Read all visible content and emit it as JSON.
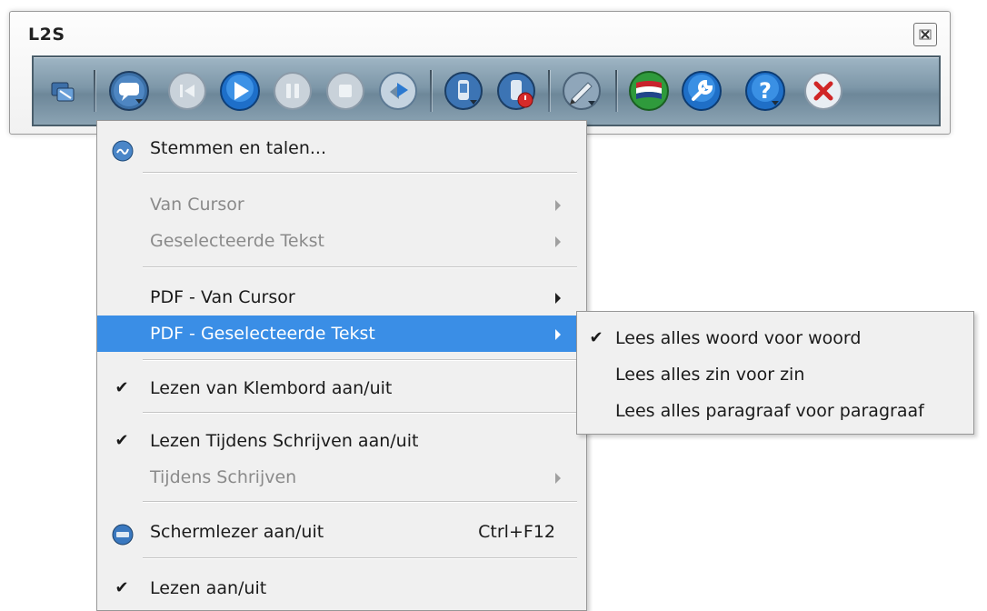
{
  "window": {
    "title": "L2S",
    "close_icon": "close-box-icon"
  },
  "toolbar": {
    "buttons": [
      {
        "name": "resize-icon"
      },
      {
        "name": "speech-bubble-menu-icon"
      },
      {
        "name": "previous-icon"
      },
      {
        "name": "play-icon"
      },
      {
        "name": "pause-icon"
      },
      {
        "name": "stop-icon"
      },
      {
        "name": "next-icon"
      },
      {
        "name": "save-audio-icon"
      },
      {
        "name": "record-audio-icon"
      },
      {
        "name": "pen-icon"
      },
      {
        "name": "dutch-flag-icon"
      },
      {
        "name": "settings-wrench-icon"
      },
      {
        "name": "help-icon"
      },
      {
        "name": "exit-icon"
      }
    ]
  },
  "menu": {
    "items": [
      {
        "label": "Stemmen en talen..."
      },
      {
        "label": "Van Cursor"
      },
      {
        "label": "Geselecteerde Tekst"
      },
      {
        "label": "PDF - Van Cursor"
      },
      {
        "label": "PDF - Geselecteerde Tekst"
      },
      {
        "label": "Lezen van Klembord aan/uit",
        "check": "✔"
      },
      {
        "label": "Lezen Tijdens Schrijven aan/uit",
        "check": "✔"
      },
      {
        "label": "Tijdens Schrijven"
      },
      {
        "label": "Schermlezer aan/uit",
        "shortcut": "Ctrl+F12"
      },
      {
        "label": "Lezen aan/uit",
        "check": "✔"
      }
    ]
  },
  "submenu": {
    "items": [
      {
        "label": "Lees alles woord voor woord",
        "check": "✔"
      },
      {
        "label": "Lees alles zin voor zin"
      },
      {
        "label": "Lees alles paragraaf voor paragraaf"
      }
    ]
  },
  "colors": {
    "highlight": "#3a8ee6",
    "toolbar": "#7d97a8",
    "menu_bg": "#f0f0f0",
    "disabled_text": "#8a8a8a"
  }
}
